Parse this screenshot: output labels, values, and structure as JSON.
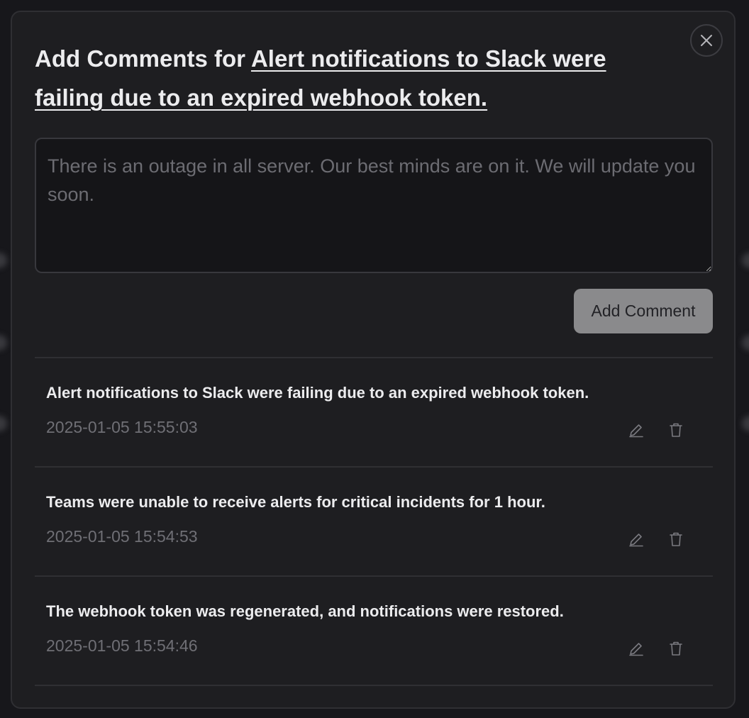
{
  "modal": {
    "title_prefix": "Add Comments for ",
    "title_link": "Alert notifications to Slack were failing due to an expired webhook token.",
    "close_icon": "close-icon"
  },
  "composer": {
    "placeholder": "There is an outage in all server. Our best minds are on it. We will update you soon.",
    "value": "",
    "add_button_label": "Add Comment"
  },
  "comments": [
    {
      "text": "Alert notifications to Slack were failing due to an expired webhook token.",
      "timestamp": "2025-01-05 15:55:03",
      "edit_icon": "pencil-icon",
      "delete_icon": "trash-icon"
    },
    {
      "text": "Teams were unable to receive alerts for critical incidents for 1 hour.",
      "timestamp": "2025-01-05 15:54:53",
      "edit_icon": "pencil-icon",
      "delete_icon": "trash-icon"
    },
    {
      "text": "The webhook token was regenerated, and notifications were restored.",
      "timestamp": "2025-01-05 15:54:46",
      "edit_icon": "pencil-icon",
      "delete_icon": "trash-icon"
    }
  ],
  "colors": {
    "backdrop": "#17171b",
    "modal_bg": "#1e1e21",
    "text_primary": "#ececee",
    "text_muted": "#6f6f75",
    "button_bg": "#8a8a8c"
  }
}
